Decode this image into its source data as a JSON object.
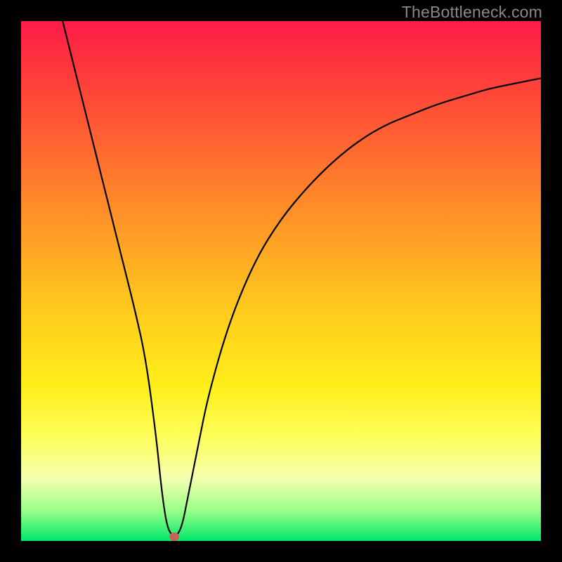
{
  "watermark": "TheBottleneck.com",
  "chart_data": {
    "type": "line",
    "title": "",
    "xlabel": "",
    "ylabel": "",
    "xlim": [
      0,
      100
    ],
    "ylim": [
      0,
      100
    ],
    "background_gradient": {
      "top_color": "#ff1b47",
      "bottom_color": "#00e86a",
      "description": "vertical red-to-green gradient (high=bad, low=good)"
    },
    "series": [
      {
        "name": "bottleneck-curve",
        "x": [
          8,
          10,
          12,
          14,
          16,
          18,
          20,
          22,
          24,
          26,
          27,
          28,
          29,
          30,
          31,
          32,
          34,
          36,
          40,
          45,
          50,
          55,
          60,
          65,
          70,
          75,
          80,
          85,
          90,
          95,
          100
        ],
        "y": [
          100,
          92,
          84,
          76,
          68,
          60,
          52,
          44,
          35,
          20,
          10,
          3,
          1,
          1,
          3,
          8,
          18,
          28,
          42,
          54,
          62,
          68,
          73,
          77,
          80,
          82,
          84,
          85.5,
          87,
          88,
          89
        ]
      }
    ],
    "marker": {
      "name": "optimal-point",
      "x": 29.5,
      "y": 0.8,
      "color": "#c9605c"
    }
  }
}
